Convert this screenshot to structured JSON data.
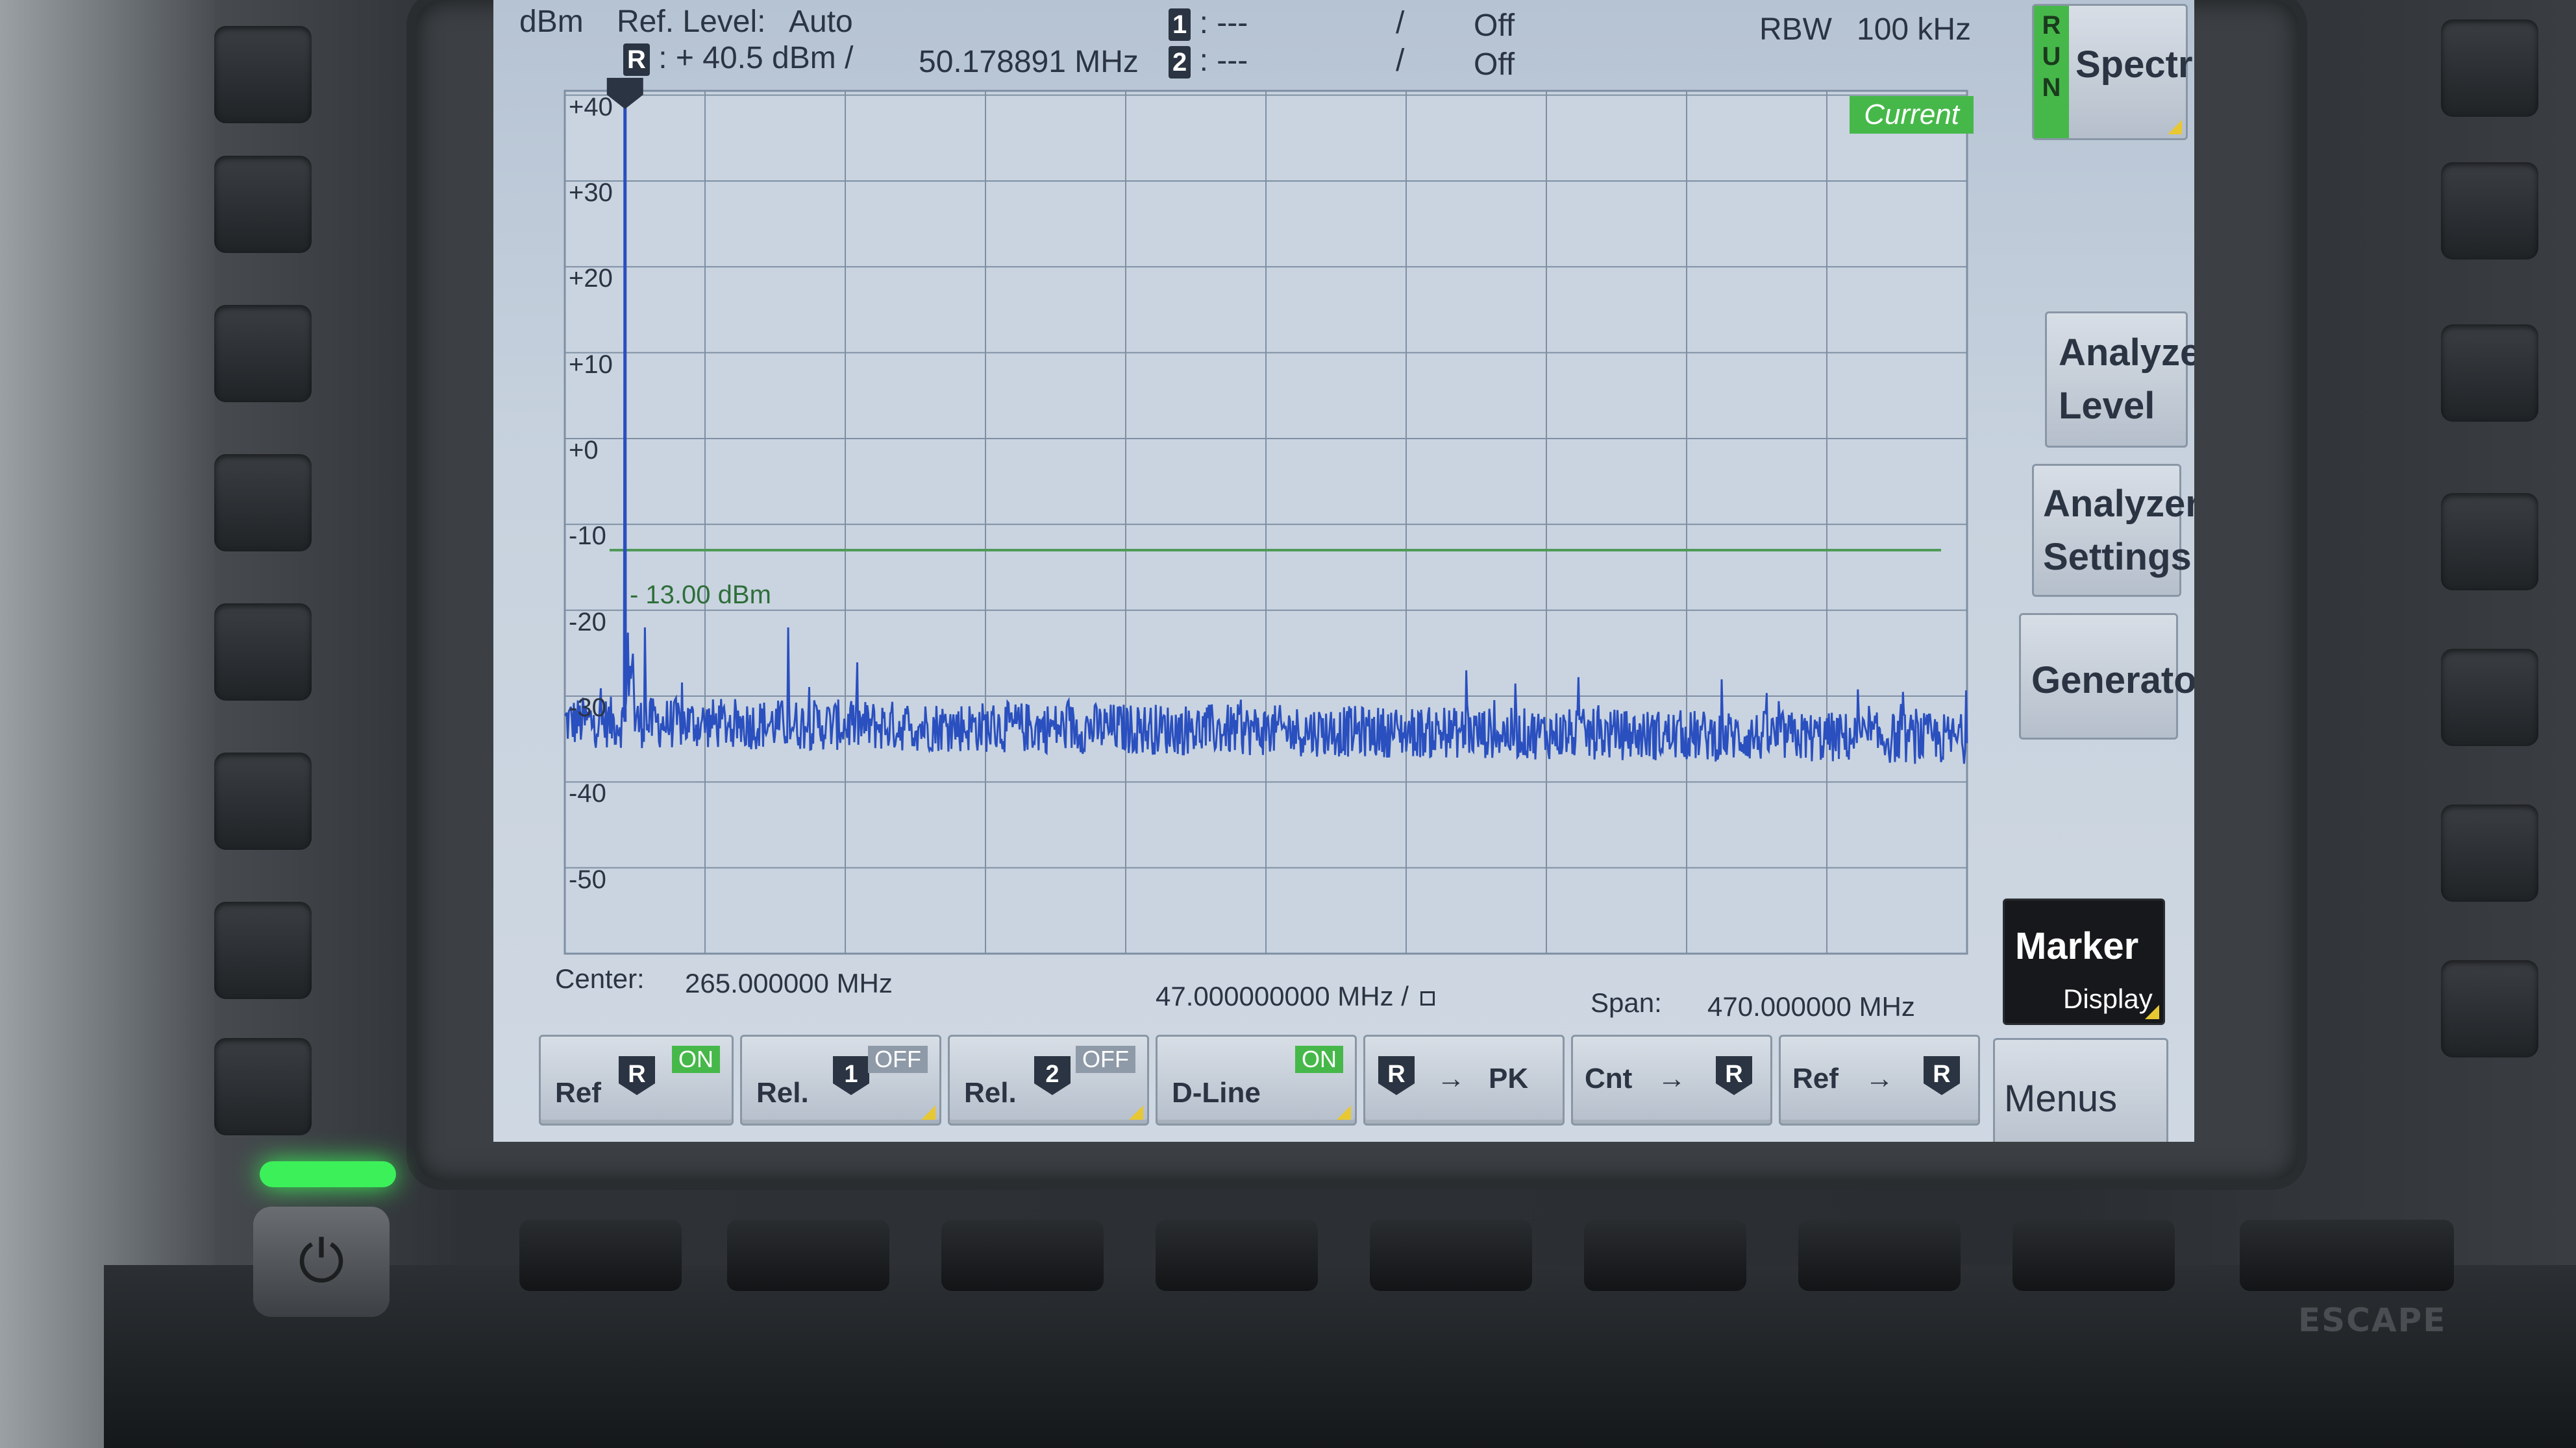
{
  "header": {
    "unit": "dBm",
    "ref_level_label": "Ref. Level:",
    "ref_level_mode": "Auto",
    "ref_marker_symbol": "R",
    "ref_level_value": ": + 40.5 dBm /",
    "ref_frequency": "50.178891  MHz",
    "marker1_symbol": "1",
    "marker1_value": ":   ---",
    "marker1_sep": "/",
    "marker1_state": "Off",
    "marker2_symbol": "2",
    "marker2_value": ":   ---",
    "marker2_sep": "/",
    "marker2_state": "Off",
    "rbw_label": "RBW",
    "rbw_value": "100 kHz"
  },
  "plot": {
    "trace_badge": "Current",
    "trace_color": "#2a4fbf",
    "grid_color": "#7f8fa3",
    "dline_color": "#4f9a57",
    "dline_label": "- 13.00 dBm",
    "y_ticks": [
      "+40",
      "+30",
      "+20",
      "+10",
      "+0",
      "-10",
      "-20",
      "-30",
      "-40",
      "-50"
    ]
  },
  "chart_data": {
    "type": "line",
    "xlabel": "",
    "ylabel": "dBm",
    "xlim": [
      30,
      500
    ],
    "ylim": [
      -60,
      40.5
    ],
    "x_unit": "MHz",
    "grid": true,
    "reference_line": {
      "label": "- 13.00 dBm",
      "y": -13
    },
    "peaks": [
      {
        "x": 50.18,
        "y": 40.5
      },
      {
        "x": 57,
        "y": -22
      },
      {
        "x": 105,
        "y": -22
      },
      {
        "x": 332,
        "y": -27
      }
    ],
    "series": [
      {
        "values_note": "",
        "noise_floor_dbm": -33
      }
    ]
  },
  "footer": {
    "center_label": "Center:",
    "center_value": "265.000000  MHz",
    "div_value": "47.000000000 MHz  /",
    "span_label": "Span:",
    "span_value": "470.000000  MHz"
  },
  "softkeys": {
    "ref": {
      "label": "Ref",
      "symbol": "R",
      "state": "ON"
    },
    "rel1": {
      "label": "Rel.",
      "symbol": "1",
      "state": "OFF"
    },
    "rel2": {
      "label": "Rel.",
      "symbol": "2",
      "state": "OFF"
    },
    "dline": {
      "label": "D-Line",
      "state": "ON"
    },
    "r_to_pk": {
      "symbol": "R",
      "arrow": "→",
      "label": "PK"
    },
    "cnt_to_r": {
      "label": "Cnt",
      "arrow": "→",
      "symbol": "R"
    },
    "ref_to_r": {
      "label": "Ref",
      "arrow": "→",
      "symbol": "R"
    }
  },
  "menu": {
    "run_letters": "R U N",
    "spectrum": "Spectrum",
    "analyzer_level_1": "Analyzer",
    "analyzer_level_2": "Level",
    "analyzer_settings_1": "Analyzer",
    "analyzer_settings_2": "Settings",
    "generator": "Generator",
    "marker": "Marker",
    "marker_sub": "Display",
    "menus": "Menus"
  },
  "hardware": {
    "escape": "ESCAPE",
    "power_icon": "power-icon"
  }
}
